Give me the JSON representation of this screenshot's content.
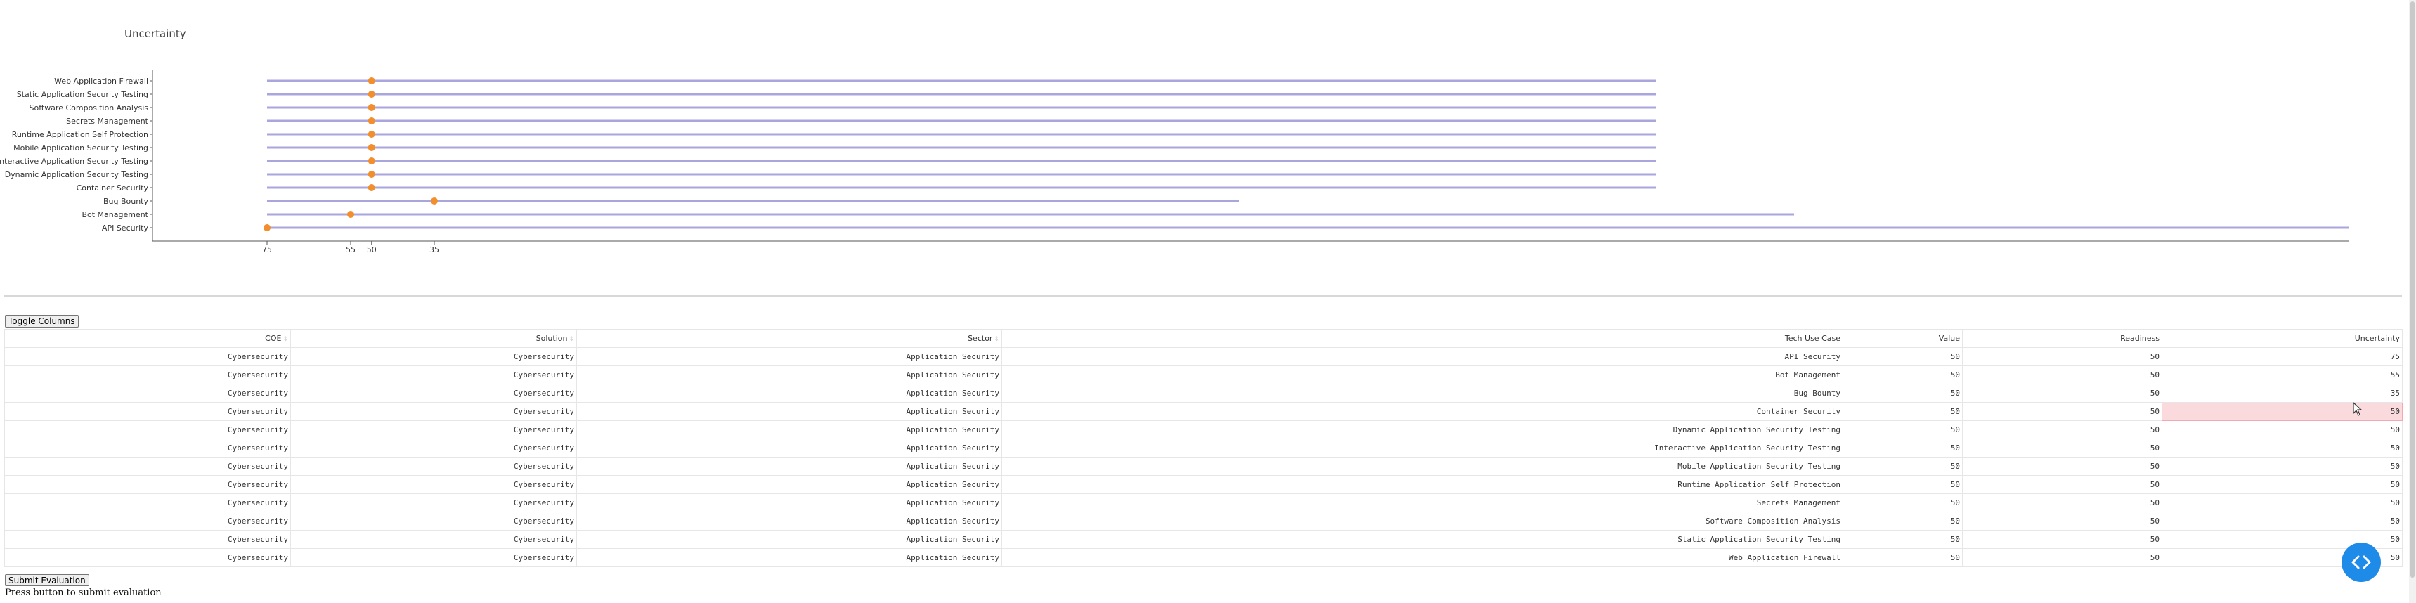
{
  "chart_data": {
    "type": "dumbbell",
    "title": "Uncertainty",
    "categories": [
      "API Security",
      "Bot Management",
      "Bug Bounty",
      "Container Security",
      "Dynamic Application Security Testing",
      "Interactive Application Security Testing",
      "Mobile Application Security Testing",
      "Runtime Application Self Protection",
      "Secrets Management",
      "Software Composition Analysis",
      "Static Application Security Testing",
      "Web Application Firewall"
    ],
    "values": [
      75,
      55,
      35,
      50,
      50,
      50,
      50,
      50,
      50,
      50,
      50,
      50
    ],
    "xticks": [
      "75",
      "55",
      "35",
      "50"
    ],
    "colors": {
      "line": "#a8a6dc",
      "point": "#f28e2b",
      "axis": "#555555"
    }
  },
  "toolbar": {
    "toggle_label": "Toggle Columns"
  },
  "table": {
    "columns": [
      "COE",
      "Solution",
      "Sector",
      "Tech Use Case",
      "Value",
      "Readiness",
      "Uncertainty"
    ],
    "rows": [
      [
        "Cybersecurity",
        "Cybersecurity",
        "Application Security",
        "API Security",
        "50",
        "50",
        "75"
      ],
      [
        "Cybersecurity",
        "Cybersecurity",
        "Application Security",
        "Bot Management",
        "50",
        "50",
        "55"
      ],
      [
        "Cybersecurity",
        "Cybersecurity",
        "Application Security",
        "Bug Bounty",
        "50",
        "50",
        "35"
      ],
      [
        "Cybersecurity",
        "Cybersecurity",
        "Application Security",
        "Container Security",
        "50",
        "50",
        "50"
      ],
      [
        "Cybersecurity",
        "Cybersecurity",
        "Application Security",
        "Dynamic Application Security Testing",
        "50",
        "50",
        "50"
      ],
      [
        "Cybersecurity",
        "Cybersecurity",
        "Application Security",
        "Interactive Application Security Testing",
        "50",
        "50",
        "50"
      ],
      [
        "Cybersecurity",
        "Cybersecurity",
        "Application Security",
        "Mobile Application Security Testing",
        "50",
        "50",
        "50"
      ],
      [
        "Cybersecurity",
        "Cybersecurity",
        "Application Security",
        "Runtime Application Self Protection",
        "50",
        "50",
        "50"
      ],
      [
        "Cybersecurity",
        "Cybersecurity",
        "Application Security",
        "Secrets Management",
        "50",
        "50",
        "50"
      ],
      [
        "Cybersecurity",
        "Cybersecurity",
        "Application Security",
        "Software Composition Analysis",
        "50",
        "50",
        "50"
      ],
      [
        "Cybersecurity",
        "Cybersecurity",
        "Application Security",
        "Static Application Security Testing",
        "50",
        "50",
        "50"
      ],
      [
        "Cybersecurity",
        "Cybersecurity",
        "Application Security",
        "Web Application Firewall",
        "50",
        "50",
        "50"
      ]
    ],
    "highlight_color": "#fadadd"
  },
  "footer": {
    "submit_label": "Submit Evaluation",
    "status_text": "Press button to submit evaluation"
  },
  "fab": {
    "icon": "code-icon",
    "color": "#1f8be8"
  }
}
